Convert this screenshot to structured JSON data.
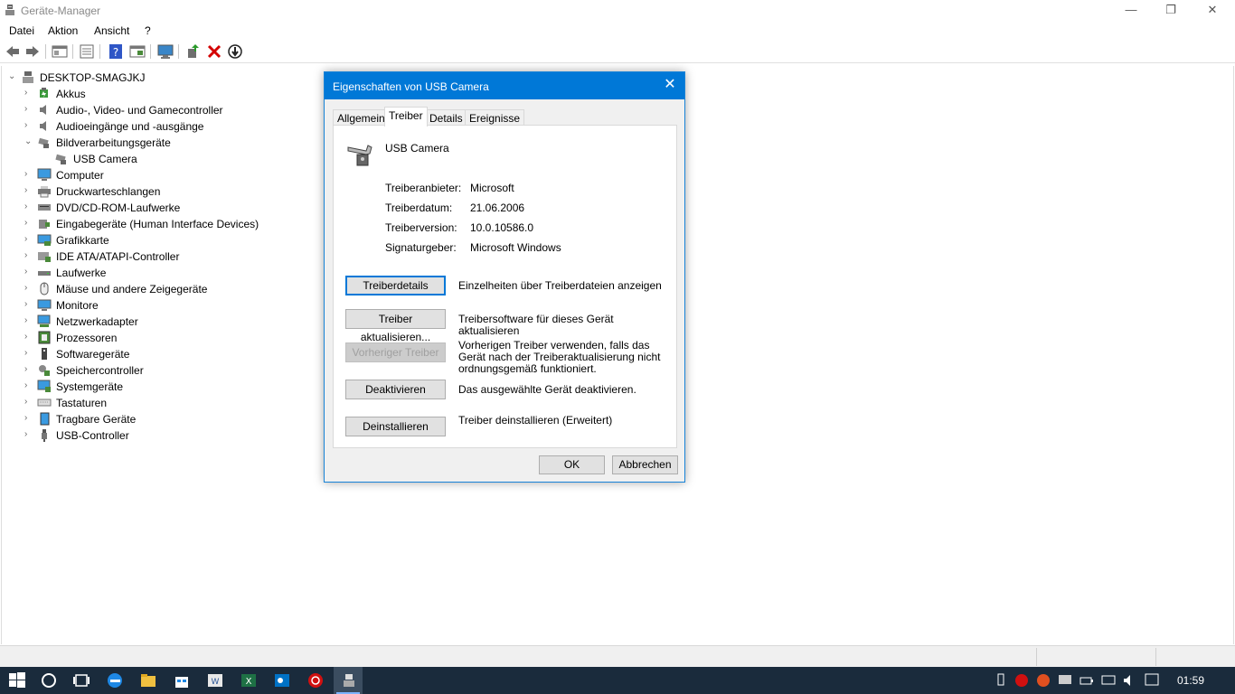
{
  "window": {
    "title": "Geräte-Manager"
  },
  "menu": {
    "items": [
      "Datei",
      "Aktion",
      "Ansicht",
      "?"
    ]
  },
  "tree": {
    "root": "DESKTOP-SMAGJKJ",
    "categories": [
      "Akkus",
      "Audio-, Video- und Gamecontroller",
      "Audioeingänge und -ausgänge",
      "Bildverarbeitungsgeräte",
      "USB Camera",
      "Computer",
      "Druckwarteschlangen",
      "DVD/CD-ROM-Laufwerke",
      "Eingabegeräte (Human Interface Devices)",
      "Grafikkarte",
      "IDE ATA/ATAPI-Controller",
      "Laufwerke",
      "Mäuse und andere Zeigegeräte",
      "Monitore",
      "Netzwerkadapter",
      "Prozessoren",
      "Softwaregeräte",
      "Speichercontroller",
      "Systemgeräte",
      "Tastaturen",
      "Tragbare Geräte",
      "USB-Controller"
    ]
  },
  "dialog": {
    "title": "Eigenschaften von USB Camera",
    "tabs": [
      "Allgemein",
      "Treiber",
      "Details",
      "Ereignisse"
    ],
    "device_name": "USB Camera",
    "props": [
      {
        "label": "Treiberanbieter:",
        "value": "Microsoft"
      },
      {
        "label": "Treiberdatum:",
        "value": "21.06.2006"
      },
      {
        "label": "Treiberversion:",
        "value": "10.0.10586.0"
      },
      {
        "label": "Signaturgeber:",
        "value": "Microsoft Windows"
      }
    ],
    "actions": [
      {
        "button": "Treiberdetails",
        "desc": "Einzelheiten über Treiberdateien anzeigen"
      },
      {
        "button": "Treiber aktualisieren...",
        "desc": "Treibersoftware für dieses Gerät aktualisieren"
      },
      {
        "button": "Vorheriger Treiber",
        "desc": "Vorherigen Treiber verwenden, falls das Gerät nach der Treiberaktualisierung nicht ordnungsgemäß funktioniert."
      },
      {
        "button": "Deaktivieren",
        "desc": "Das ausgewählte Gerät deaktivieren."
      },
      {
        "button": "Deinstallieren",
        "desc": "Treiber deinstallieren (Erweitert)"
      }
    ],
    "ok": "OK",
    "cancel": "Abbrechen"
  },
  "taskbar": {
    "clock": "01:59"
  }
}
